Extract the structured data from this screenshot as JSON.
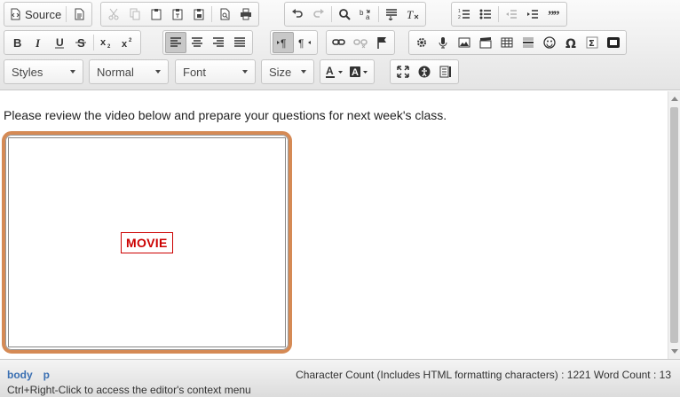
{
  "toolbar": {
    "source_label": "Source",
    "styles_label": "Styles",
    "format_label": "Normal",
    "font_label": "Font",
    "size_label": "Size",
    "accent_color": "#d58a55",
    "movie_color": "#cc0000"
  },
  "content": {
    "paragraph": "Please review the video below and prepare your questions for next week's class.",
    "movie_placeholder": "MOVIE"
  },
  "status": {
    "path_items": [
      "body",
      "p"
    ],
    "count_text": "Character Count (Includes HTML formatting characters) : 1221 Word Count : 13",
    "hint": "Ctrl+Right-Click to access the editor's context menu"
  }
}
